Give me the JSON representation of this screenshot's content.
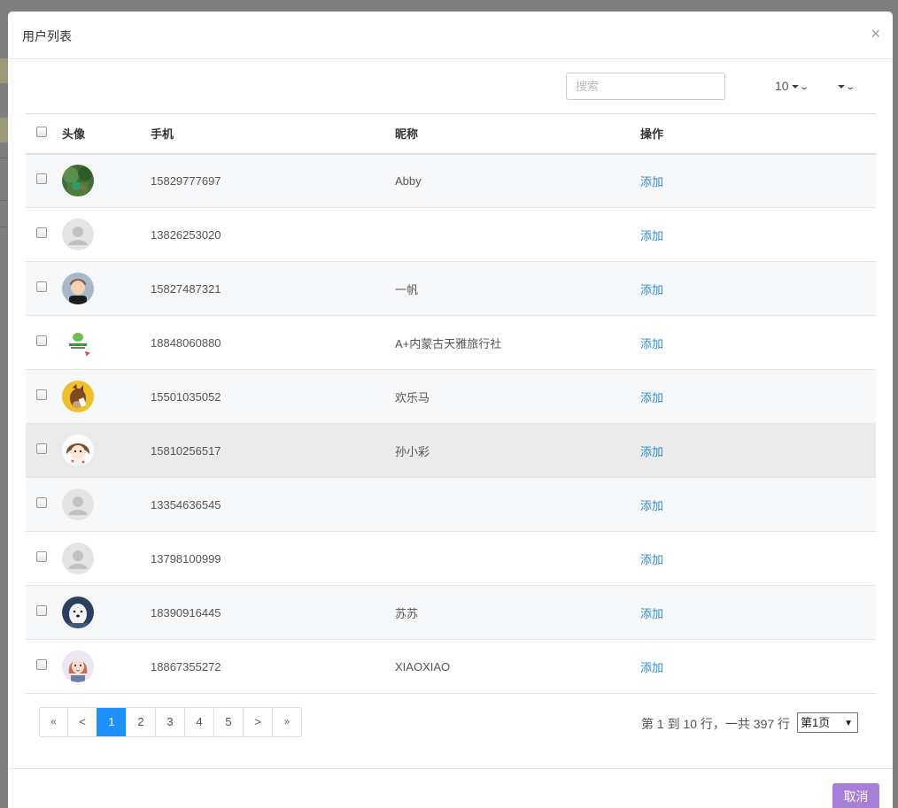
{
  "modal": {
    "title": "用户列表",
    "close_symbol": "×"
  },
  "toolbar": {
    "search_placeholder": "搜索",
    "page_size": "10"
  },
  "table": {
    "headers": {
      "avatar": "头像",
      "phone": "手机",
      "nickname": "昵称",
      "action": "操作"
    },
    "rows": [
      {
        "phone": "15829777697",
        "nickname": "Abby",
        "action": "添加",
        "avatar": "nature-photo"
      },
      {
        "phone": "13826253020",
        "nickname": "",
        "action": "添加",
        "avatar": "default-user"
      },
      {
        "phone": "15827487321",
        "nickname": "一帆",
        "action": "添加",
        "avatar": "cartoon-boy"
      },
      {
        "phone": "18848060880",
        "nickname": "A+内蒙古天雅旅行社",
        "action": "添加",
        "avatar": "travel-logo"
      },
      {
        "phone": "15501035052",
        "nickname": "欢乐马",
        "action": "添加",
        "avatar": "horse-cartoon"
      },
      {
        "phone": "15810256517",
        "nickname": "孙小彩",
        "action": "添加",
        "avatar": "cartoon-girl"
      },
      {
        "phone": "13354636545",
        "nickname": "",
        "action": "添加",
        "avatar": "default-user"
      },
      {
        "phone": "13798100999",
        "nickname": "",
        "action": "添加",
        "avatar": "default-user"
      },
      {
        "phone": "18390916445",
        "nickname": "苏苏",
        "action": "添加",
        "avatar": "white-dog"
      },
      {
        "phone": "18867355272",
        "nickname": "XIAOXIAO",
        "action": "添加",
        "avatar": "cartoon-woman"
      }
    ]
  },
  "pagination": {
    "first": "«",
    "prev": "<",
    "pages": [
      "1",
      "2",
      "3",
      "4",
      "5"
    ],
    "active_page": "1",
    "next": ">",
    "last": "»",
    "info": "第 1 到 10 行，一共 397 行",
    "page_select": "第1页"
  },
  "footer": {
    "cancel_label": "取消"
  },
  "colors": {
    "link": "#2a8ad4",
    "active_page": "#1e90ff",
    "cancel_button": "#a57fd8"
  }
}
